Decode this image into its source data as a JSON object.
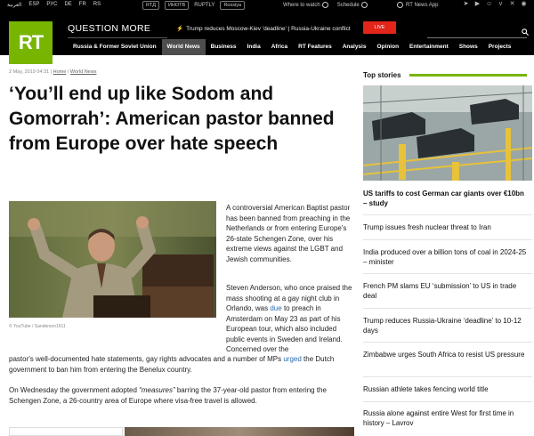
{
  "topbar": {
    "languages": [
      "العربية",
      "ESP",
      "РУС",
      "DE",
      "FR",
      "RS"
    ],
    "channels": [
      "RTД",
      "ИНОТВ",
      "RUPTLY",
      "Rossiya"
    ],
    "where_to_watch": "Where to watch",
    "schedule": "Schedule",
    "app": "RT News App"
  },
  "header": {
    "logo": "RT",
    "question_more": "QUESTION MORE",
    "breaking": "Trump reduces Moscow-Kiev 'deadline' | Russia-Ukraine conflict",
    "live_label": "LIVE",
    "nav": [
      "Russia & Former Soviet Union",
      "World News",
      "Business",
      "India",
      "Africa",
      "RT Features",
      "Analysis",
      "Opinion",
      "Entertainment",
      "Shows",
      "Projects"
    ],
    "active_nav": "World News"
  },
  "article": {
    "date": "2 May, 2019 04:31",
    "breadcrumb": [
      "Home",
      "World News"
    ],
    "title": "‘You’ll end up like Sodom and Gomorrah’: American pastor banned from Europe over hate speech",
    "photo_credit": "© YouTube / Sanderson1611",
    "p1": "A controversial American Baptist pastor has been banned from preaching in the Netherlands or from entering Europe's 26-state Schengen Zone, over his extreme views against the LGBT and Jewish communities.",
    "p2_a": "Steven Anderson, who once praised the mass shooting at a gay night club in Orlando, was ",
    "p2_link1": "due",
    "p2_b": " to preach in Amsterdam on May 23 as part of his European tour, which also included public events in Sweden and Ireland. Concerned over the",
    "p2_c": "pastor's well-documented hate statements, gay rights advocates and a number of MPs ",
    "p2_link2": "urged",
    "p2_d": " the Dutch government to ban him from entering the Benelux country.",
    "p3_a": "On Wednesday the government adopted ",
    "p3_em": "“measures”",
    "p3_b": " barring the 37-year-old pastor from entering the Schengen Zone, a 26-country area of Europe where visa-free travel is allowed."
  },
  "sidebar": {
    "title": "Top stories",
    "stories": [
      "US tariffs to cost German car giants over €10bn – study",
      "Trump issues fresh nuclear threat to Iran",
      "India produced over a billion tons of coal in 2024-25 – minister",
      "French PM slams EU ‘submission’ to US in trade deal",
      "Trump reduces Russia-Ukraine ‘deadline’ to 10-12 days",
      "Zimbabwe urges South Africa to resist US pressure",
      "Russian athlete takes fencing world title",
      "Russia alone against entire West for first time in history – Lavrov"
    ]
  },
  "colors": {
    "brand_green": "#77b500",
    "live_red": "#e3251a",
    "link_blue": "#2a6bb0"
  }
}
